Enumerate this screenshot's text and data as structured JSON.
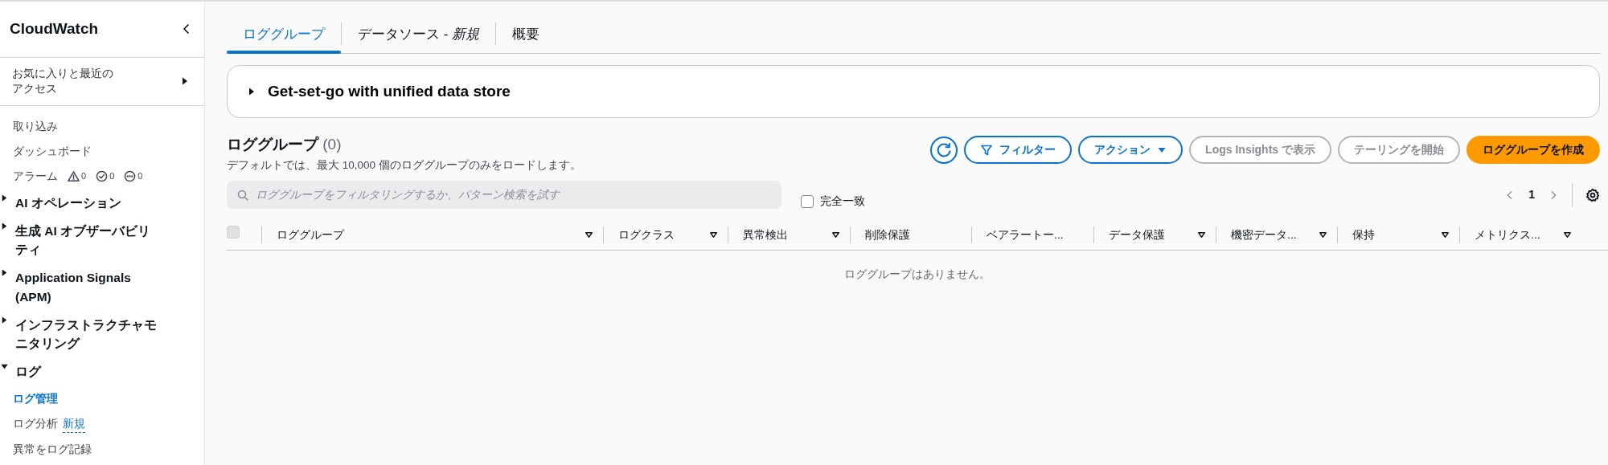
{
  "sidebar": {
    "title": "CloudWatch",
    "favorites": {
      "label": "お気に入りと最近のアクセス",
      "expanded": false
    },
    "items": [
      {
        "kind": "link",
        "label": "取り込み",
        "selected": false
      },
      {
        "kind": "link",
        "label": "ダッシュボード",
        "selected": false
      },
      {
        "kind": "alarms",
        "label": "アラーム",
        "counts": [
          {
            "kind": "alarm",
            "count": "0"
          },
          {
            "kind": "ok",
            "count": "0"
          },
          {
            "kind": "insufficient",
            "count": "0"
          }
        ]
      },
      {
        "kind": "section",
        "label": "AI オペレーション",
        "expanded": false
      },
      {
        "kind": "section",
        "label": "生成 AI オブザーバビリティ",
        "expanded": false
      },
      {
        "kind": "section",
        "label": "Application Signals (APM)",
        "expanded": false
      },
      {
        "kind": "section",
        "label": "インフラストラクチャモニタリング",
        "expanded": false
      },
      {
        "kind": "section",
        "label": "ログ",
        "expanded": true,
        "children": [
          {
            "kind": "link",
            "label": "ログ管理",
            "selected": true
          },
          {
            "kind": "link",
            "label": "ログ分析",
            "badge": "新規",
            "selected": false
          },
          {
            "kind": "link",
            "label": "異常をログ記録",
            "selected": false
          }
        ]
      }
    ]
  },
  "tabs": [
    {
      "label": "ロググループ",
      "selected": true
    },
    {
      "label": "データソース - *新規*",
      "selected": false
    },
    {
      "label": "概要",
      "selected": false
    }
  ],
  "banner": {
    "title": "Get-set-go with unified data store",
    "expanded": false
  },
  "header": {
    "title": "ロググループ",
    "count": "(0)",
    "description": "デフォルトでは、最大 10,000 個のロググループのみをロードします。",
    "buttons": [
      {
        "kind": "refresh",
        "disabled": false
      },
      {
        "kind": "filter",
        "label": "フィルター",
        "disabled": false
      },
      {
        "kind": "dropdown",
        "label": "アクション",
        "disabled": false
      },
      {
        "kind": "normal",
        "label": "Logs Insights で表示",
        "disabled": true
      },
      {
        "kind": "normal",
        "label": "テーリングを開始",
        "disabled": true
      },
      {
        "kind": "primary",
        "label": "ロググループを作成",
        "disabled": false
      }
    ]
  },
  "search": {
    "placeholder": "ロググループをフィルタリングするか、パターン検索を試す"
  },
  "exact_match": {
    "label": "完全一致",
    "checked": false
  },
  "pagination": {
    "page": "1"
  },
  "table": {
    "select_all_checked": false,
    "columns": [
      {
        "label": "ロググループ",
        "sortable": true
      },
      {
        "label": "ログクラス",
        "sortable": true
      },
      {
        "label": "異常検出",
        "sortable": true
      },
      {
        "label": "削除保護",
        "sortable": false
      },
      {
        "label": "ベアラートー...",
        "sortable": false
      },
      {
        "label": "データ保護",
        "sortable": true
      },
      {
        "label": "機密データ...",
        "sortable": true
      },
      {
        "label": "保持",
        "sortable": true
      },
      {
        "label": "メトリクス...",
        "sortable": true
      }
    ],
    "empty_message": "ロググループはありません。"
  }
}
